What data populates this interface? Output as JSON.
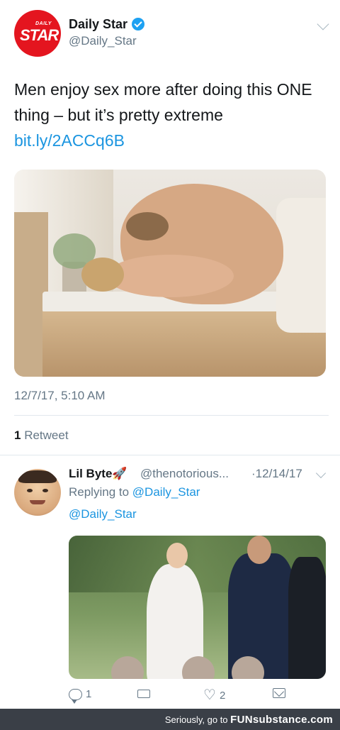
{
  "tweet": {
    "account": {
      "logo_small": "DAILY",
      "logo_large": "STAR",
      "display_name": "Daily Star",
      "handle": "@Daily_Star",
      "verified": true
    },
    "text": "Men enjoy sex more after doing this ONE thing – but it’s pretty extreme",
    "link": "bit.ly/2ACCq6B",
    "timestamp": "12/7/17, 5:10 AM",
    "retweets": {
      "count": "1",
      "label": "Retweet"
    }
  },
  "reply": {
    "display_name": "Lil Byte🚀",
    "handle": "@thenotorious...",
    "date": "·12/14/17",
    "replying_prefix": "Replying to",
    "replying_to": "@Daily_Star",
    "body": "@Daily_Star",
    "actions": {
      "reply_count": "1",
      "like_count": "2"
    }
  },
  "footer": {
    "text": "Seriously, go to",
    "brand": "FUNsubstance.com"
  },
  "colors": {
    "brand_red": "#e4151f",
    "link_blue": "#1b95e0",
    "secondary_text": "#657786",
    "footer_bg": "#3a3f47"
  },
  "icons": [
    "verified-badge-icon",
    "chevron-down-icon",
    "reply-icon",
    "retweet-icon",
    "like-icon",
    "direct-message-icon"
  ]
}
